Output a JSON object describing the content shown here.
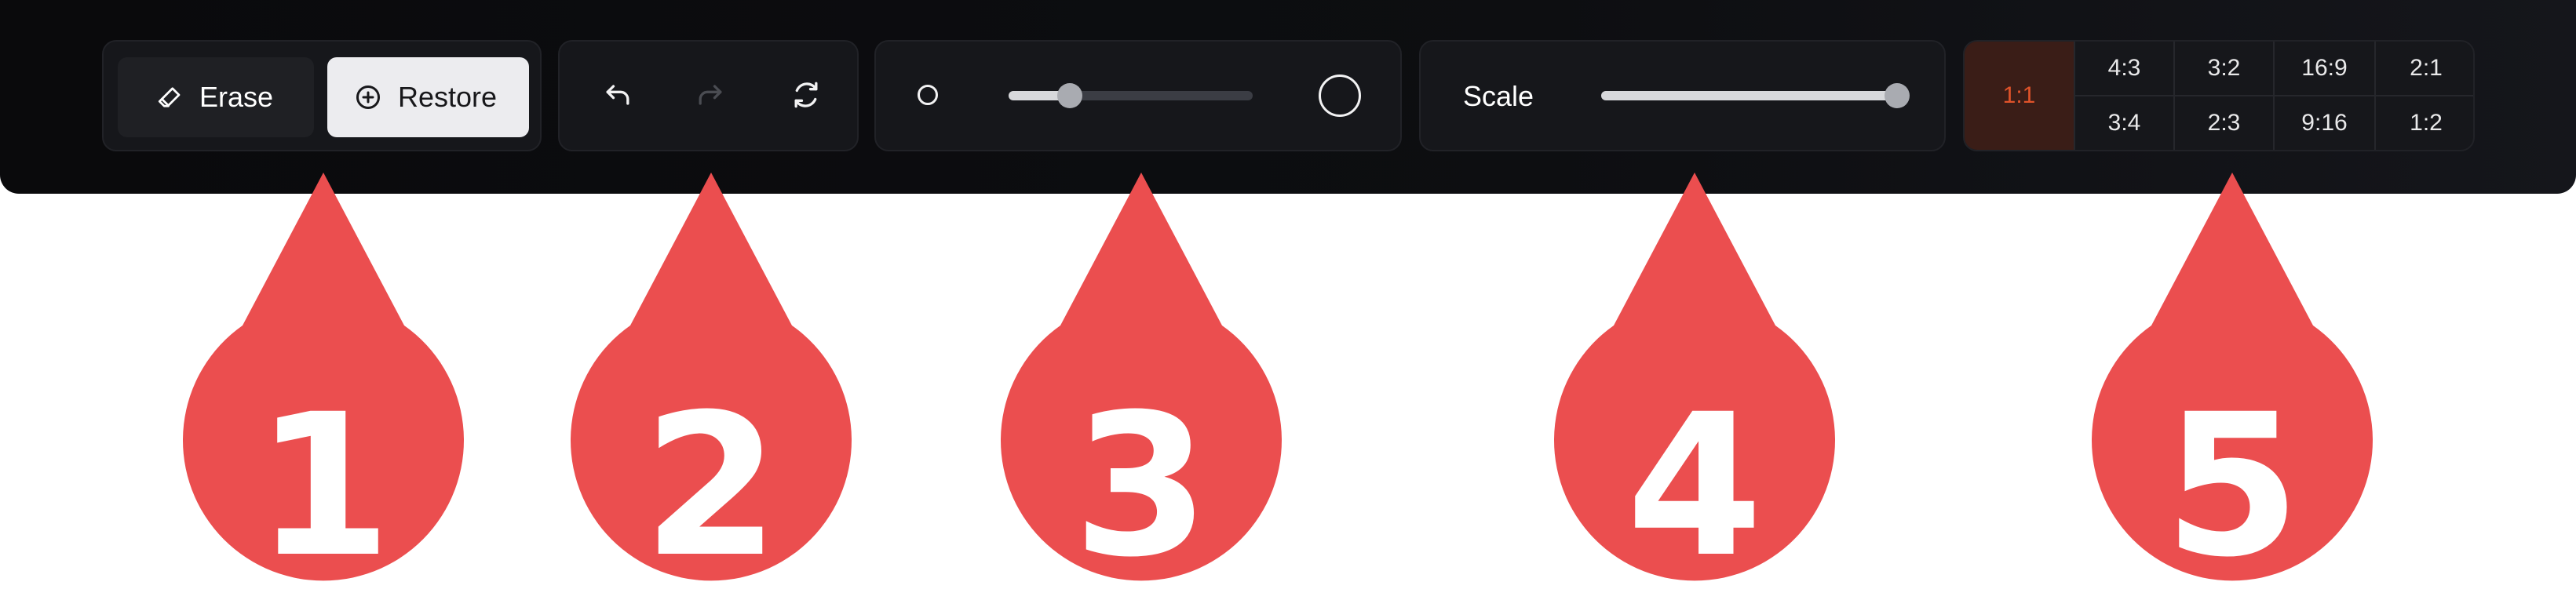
{
  "toolbar": {
    "mode": {
      "erase_label": "Erase",
      "restore_label": "Restore",
      "active": "restore"
    },
    "history": {
      "undo_icon": "undo-icon",
      "redo_icon": "redo-icon",
      "reset_icon": "refresh-icon",
      "redo_enabled": false
    },
    "brush": {
      "min_icon": "small-circle-icon",
      "max_icon": "large-circle-icon",
      "value": 0.25
    },
    "scale": {
      "label": "Scale",
      "value": 1.0
    },
    "aspect_ratio": {
      "selected": "1:1",
      "top_row": [
        "4:3",
        "3:2",
        "16:9",
        "2:1"
      ],
      "bottom_row": [
        "3:4",
        "2:3",
        "9:16",
        "1:2"
      ]
    }
  },
  "callouts": [
    {
      "number": "1"
    },
    {
      "number": "2"
    },
    {
      "number": "3"
    },
    {
      "number": "4"
    },
    {
      "number": "5"
    }
  ],
  "colors": {
    "toolbar_bg": "#0d0e11",
    "group_bg": "#16171b",
    "accent": "#e0532a",
    "callout": "#eb4e4f"
  }
}
